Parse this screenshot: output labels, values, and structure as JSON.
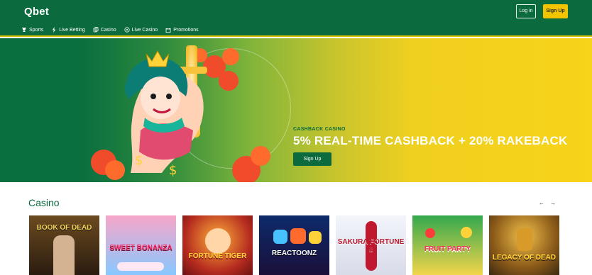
{
  "header": {
    "logo": "Qbet",
    "login_label": "Log in",
    "signup_label": "Sign Up",
    "nav": [
      {
        "label": "Sports",
        "icon": "trophy-icon"
      },
      {
        "label": "Live Betting",
        "icon": "lightning-icon"
      },
      {
        "label": "Casino",
        "icon": "cards-icon"
      },
      {
        "label": "Live Casino",
        "icon": "roulette-icon"
      },
      {
        "label": "Promotions",
        "icon": "gift-icon"
      }
    ]
  },
  "hero": {
    "kicker": "CASHBACK CASINO",
    "title": "5% REAL-TIME CASHBACK + 20% RAKEBACK",
    "cta_label": "Sign Up",
    "slides": 5,
    "active_slide": 3
  },
  "casino": {
    "title": "Casino",
    "prev_arrow": "←",
    "next_arrow": "→",
    "games": [
      {
        "title": "BOOK OF DEAD",
        "palette": [
          "#6b4a1f",
          "#2b1c10"
        ]
      },
      {
        "title": "SWEET BONANZA",
        "palette": [
          "#f7a6c9",
          "#88c8ff"
        ]
      },
      {
        "title": "FORTUNE TIGER",
        "palette": [
          "#ff6b2b",
          "#7a1a1a"
        ]
      },
      {
        "title": "REACTOONZ",
        "palette": [
          "#0d2b6b",
          "#1a0f3a"
        ]
      },
      {
        "title": "SAKURA FORTUNE II",
        "palette": [
          "#f3f5fb",
          "#d8dbe8"
        ]
      },
      {
        "title": "FRUIT PARTY",
        "palette": [
          "#33a84d",
          "#f3d54b"
        ]
      },
      {
        "title": "LEGACY OF DEAD",
        "palette": [
          "#3b2a12",
          "#9b6c24"
        ]
      }
    ]
  },
  "colors": {
    "brand_green": "#0b6b3e",
    "accent_yellow": "#f3c500",
    "hero_yellow": "#f7d31a"
  }
}
